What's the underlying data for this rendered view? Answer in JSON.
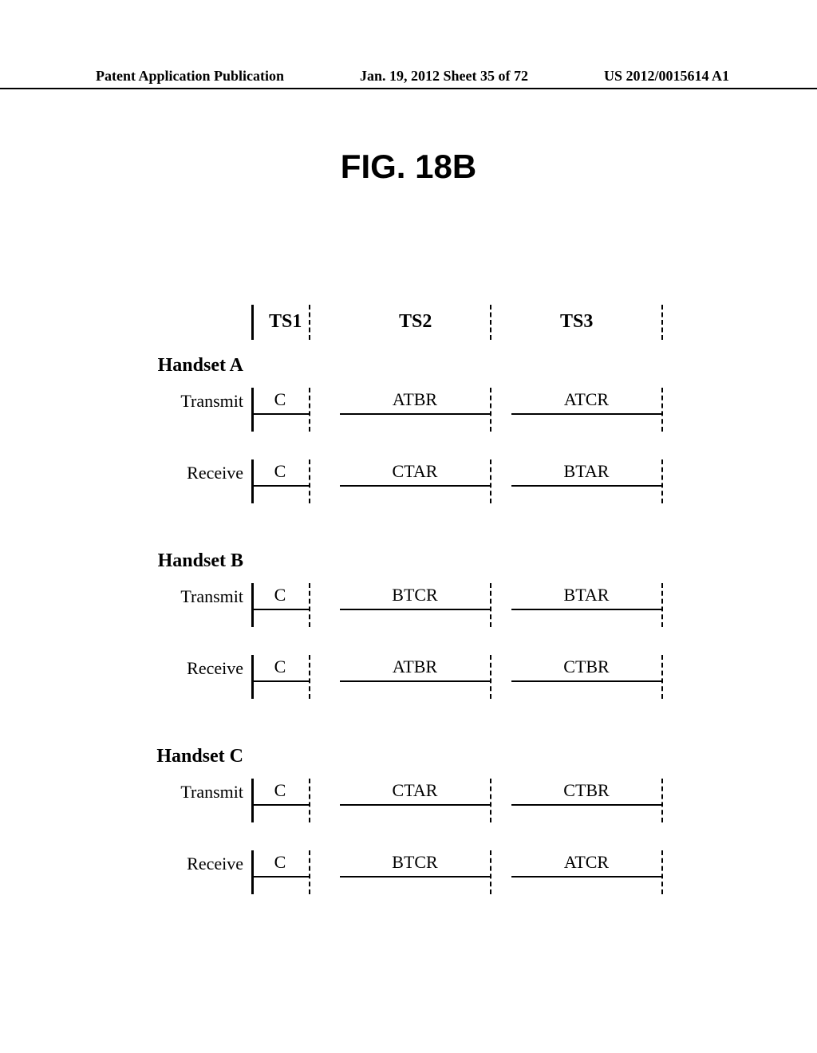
{
  "header": {
    "left": "Patent Application Publication",
    "center": "Jan. 19, 2012  Sheet 35 of 72",
    "right": "US 2012/0015614 A1"
  },
  "figure_title": "FIG. 18B",
  "columns": {
    "ts1": "TS1",
    "ts2": "TS2",
    "ts3": "TS3"
  },
  "handsets": [
    {
      "name": "Handset A",
      "transmit": {
        "ts1": "C",
        "ts2": "ATBR",
        "ts3": "ATCR"
      },
      "receive": {
        "ts1": "C",
        "ts2": "CTAR",
        "ts3": "BTAR"
      }
    },
    {
      "name": "Handset B",
      "transmit": {
        "ts1": "C",
        "ts2": "BTCR",
        "ts3": "BTAR"
      },
      "receive": {
        "ts1": "C",
        "ts2": "ATBR",
        "ts3": "CTBR"
      }
    },
    {
      "name": "Handset C",
      "transmit": {
        "ts1": "C",
        "ts2": "CTAR",
        "ts3": "CTBR"
      },
      "receive": {
        "ts1": "C",
        "ts2": "BTCR",
        "ts3": "ATCR"
      }
    }
  ],
  "labels": {
    "transmit": "Transmit",
    "receive": "Receive"
  }
}
